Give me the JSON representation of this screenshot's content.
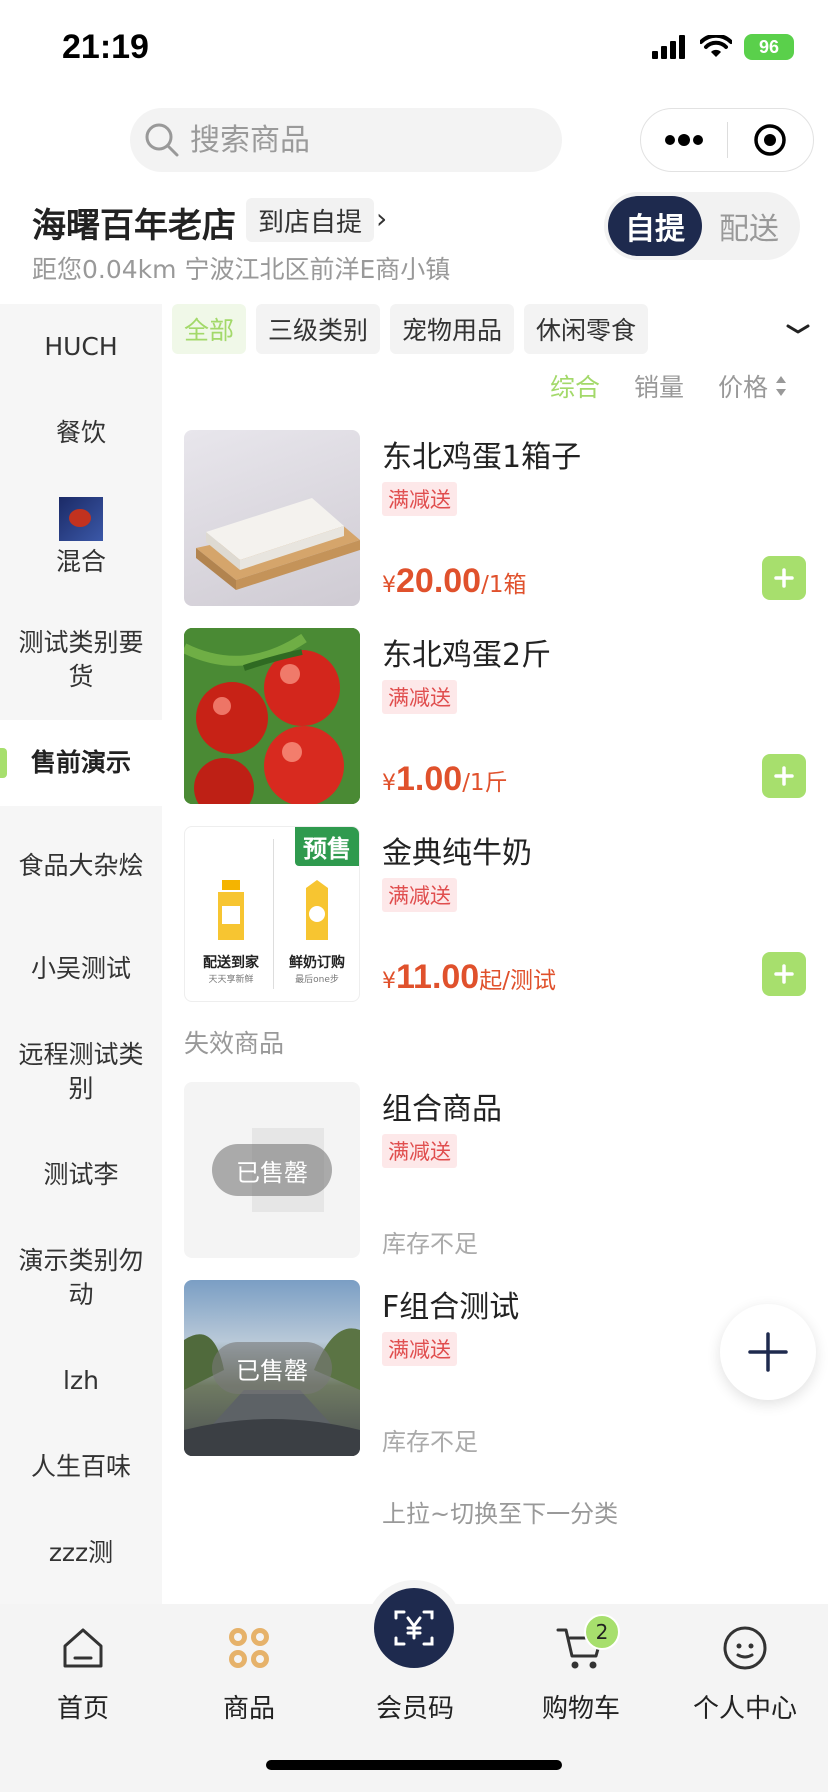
{
  "status_bar": {
    "time": "21:19",
    "battery": "96"
  },
  "search": {
    "placeholder": "搜索商品"
  },
  "store": {
    "name": "海曙百年老店",
    "pickup_tag": "到店自提",
    "arrow": "›",
    "address": "距您0.04km 宁波江北区前洋E商小镇",
    "modes": [
      "自提",
      "配送"
    ],
    "active_mode": "自提"
  },
  "sidebar": {
    "items": [
      {
        "label": "HUCH"
      },
      {
        "label": "餐饮"
      },
      {
        "label": "混合",
        "icon": "food-thumbnail"
      },
      {
        "label": "测试类别要货"
      },
      {
        "label": "售前演示",
        "active": true
      },
      {
        "label": "食品大杂烩"
      },
      {
        "label": "小吴测试"
      },
      {
        "label": "远程测试类别"
      },
      {
        "label": "测试李"
      },
      {
        "label": "演示类别勿动"
      },
      {
        "label": "lzh"
      },
      {
        "label": "人生百味"
      },
      {
        "label": "zzz测"
      }
    ]
  },
  "chips": [
    "全部",
    "三级类别",
    "宠物用品",
    "休闲零食"
  ],
  "sort": {
    "comprehensive": "综合",
    "sales": "销量",
    "price": "价格"
  },
  "products": [
    {
      "name": "东北鸡蛋1箱子",
      "promo": "满减送",
      "currency": "¥",
      "price": "20.00",
      "unit": "/1箱"
    },
    {
      "name": "东北鸡蛋2斤",
      "promo": "满减送",
      "currency": "¥",
      "price": "1.00",
      "unit": "/1斤"
    },
    {
      "name": "金典纯牛奶",
      "promo": "满减送",
      "currency": "¥",
      "price": "11.00",
      "unit": "起/测试",
      "badge": "预售",
      "img_text_left": "配送到家",
      "img_sub_left": "天天享新鲜",
      "img_text_right": "鲜奶订购",
      "img_sub_right": "最后one步"
    }
  ],
  "invalid_section": {
    "title": "失效商品",
    "items": [
      {
        "name": "组合商品",
        "promo": "满减送",
        "overlay": "已售罄",
        "stock": "库存不足"
      },
      {
        "name": "F组合测试",
        "promo": "满减送",
        "overlay": "已售罄",
        "stock": "库存不足"
      }
    ]
  },
  "footer_hint": "上拉~切换至下一分类",
  "tabbar": {
    "items": [
      {
        "label": "首页",
        "icon": "home-icon"
      },
      {
        "label": "商品",
        "icon": "grid-icon"
      },
      {
        "label": "会员码",
        "icon": "member-code-icon"
      },
      {
        "label": "购物车",
        "icon": "cart-icon"
      },
      {
        "label": "个人中心",
        "icon": "profile-icon"
      }
    ],
    "cart_count": "2"
  },
  "colors": {
    "accent_green": "#a7df6d",
    "navy": "#1e2a4e",
    "price_red": "#e0512c",
    "promo_bg": "#fde8e9",
    "presale_green": "#2f9a4e"
  }
}
